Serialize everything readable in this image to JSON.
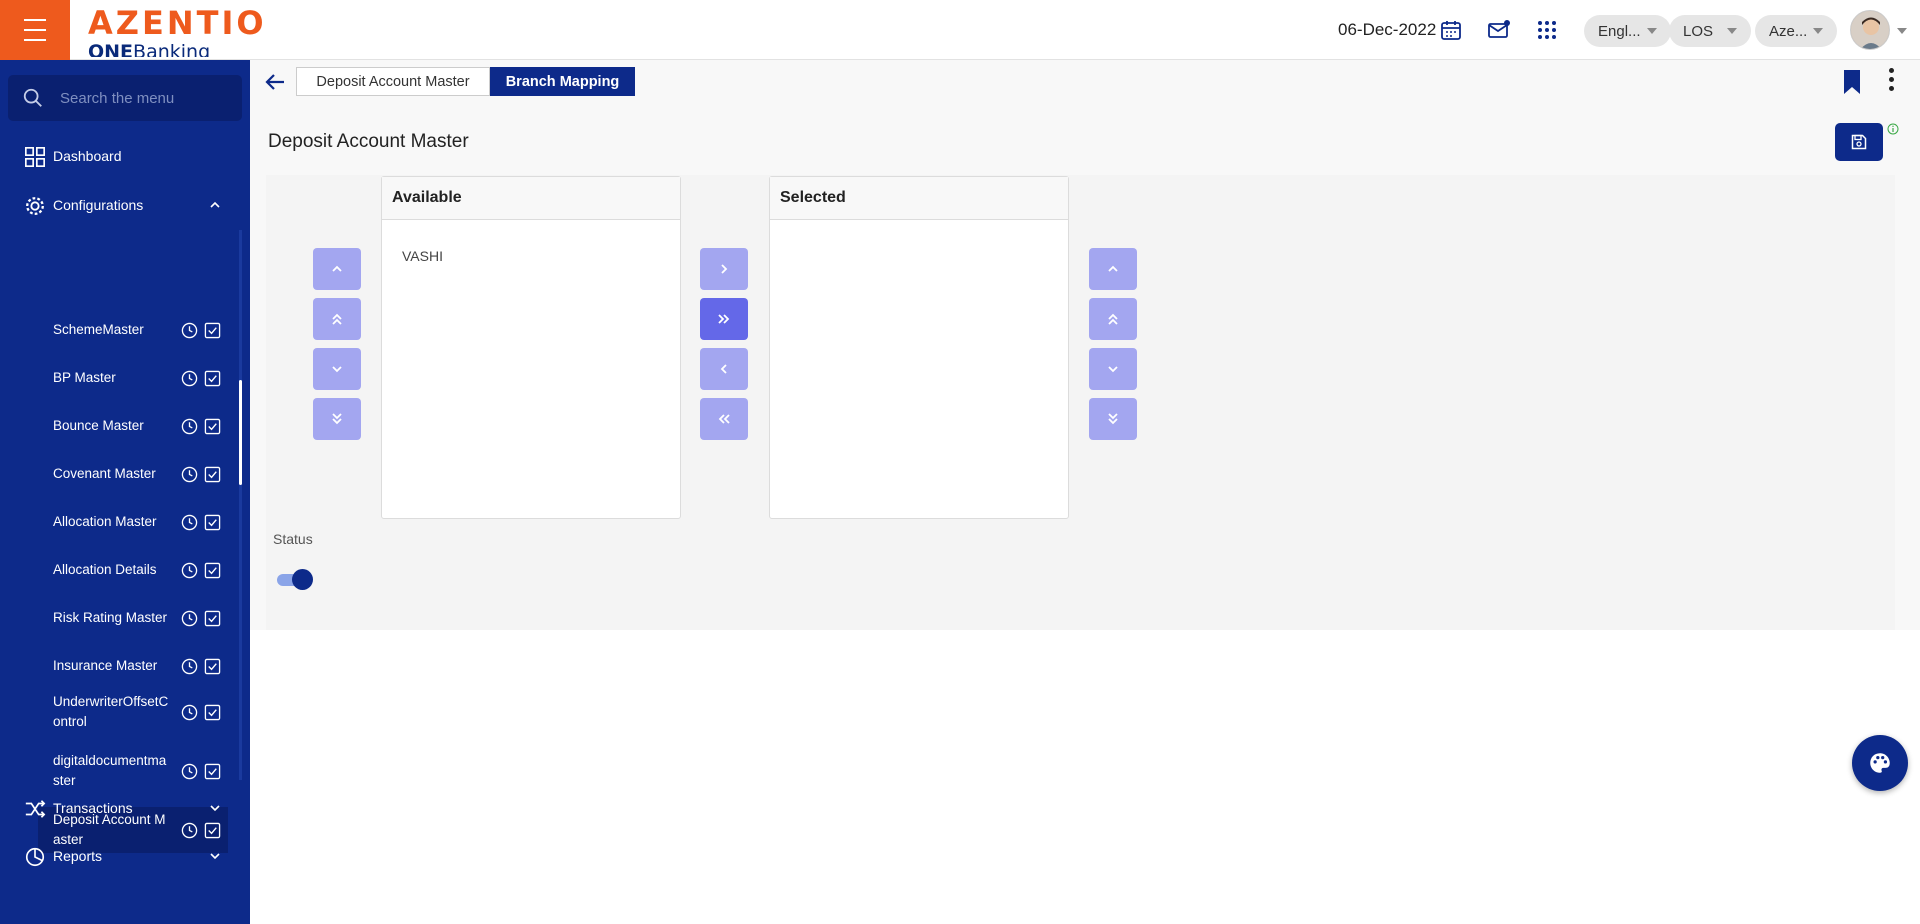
{
  "header": {
    "logo_main": "AZENTIO",
    "logo_sub_bold": "ONE",
    "logo_sub_rest": "Banking",
    "date": "06-Dec-2022",
    "pills": [
      {
        "label": "Engl..."
      },
      {
        "label": "LOS"
      },
      {
        "label": "Aze..."
      }
    ],
    "icons": [
      "calendar-icon",
      "mail-icon",
      "apps-grid-icon"
    ]
  },
  "sidebar": {
    "search_placeholder": "Search the menu",
    "top_items": [
      {
        "label": "Dashboard",
        "icon": "dashboard-icon"
      },
      {
        "label": "Configurations",
        "icon": "gear-icon",
        "expanded": true
      }
    ],
    "sub_items": [
      {
        "label": "SchemeMaster"
      },
      {
        "label": "BP Master"
      },
      {
        "label": "Bounce Master"
      },
      {
        "label": "Covenant Master"
      },
      {
        "label": "Allocation Master"
      },
      {
        "label": "Allocation Details"
      },
      {
        "label": "Risk Rating Master"
      },
      {
        "label": "Insurance Master"
      },
      {
        "label": "UnderwriterOffsetControl"
      },
      {
        "label": "digitaldocumentmaster"
      },
      {
        "label": "Deposit Account Master",
        "active": true
      }
    ],
    "bottom_items": [
      {
        "label": "Transactions",
        "icon": "shuffle-icon"
      },
      {
        "label": "Reports",
        "icon": "pie-chart-icon"
      }
    ]
  },
  "tabs": [
    {
      "label": "Deposit Account Master",
      "active": false
    },
    {
      "label": "Branch Mapping",
      "active": true
    }
  ],
  "page": {
    "title": "Deposit Account Master",
    "available": {
      "header": "Available",
      "items": [
        "VASHI"
      ]
    },
    "selected": {
      "header": "Selected",
      "items": []
    },
    "status_label": "Status",
    "status_on": true
  },
  "colors": {
    "brand_orange": "#ee5a1d",
    "navy": "#0d2a8a",
    "button_light": "#a3a6f0",
    "button_active": "#6468e8"
  }
}
